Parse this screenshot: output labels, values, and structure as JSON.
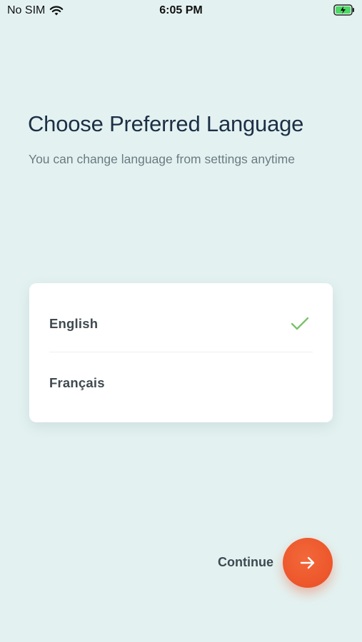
{
  "status_bar": {
    "carrier": "No SIM",
    "time": "6:05 PM",
    "wifi_icon": "wifi-icon",
    "battery_icon": "battery-charging-icon"
  },
  "header": {
    "title": "Choose Preferred Language",
    "subtitle": "You can change language from settings anytime"
  },
  "languages": {
    "items": [
      {
        "label": "English",
        "selected": true
      },
      {
        "label": "Français",
        "selected": false
      }
    ],
    "selected_icon": "check-icon"
  },
  "footer": {
    "continue_label": "Continue",
    "continue_icon": "arrow-right-icon"
  },
  "colors": {
    "background": "#e3f2f1",
    "title": "#1d2f45",
    "accent": "#ea4e24",
    "check": "#7cc26a"
  }
}
